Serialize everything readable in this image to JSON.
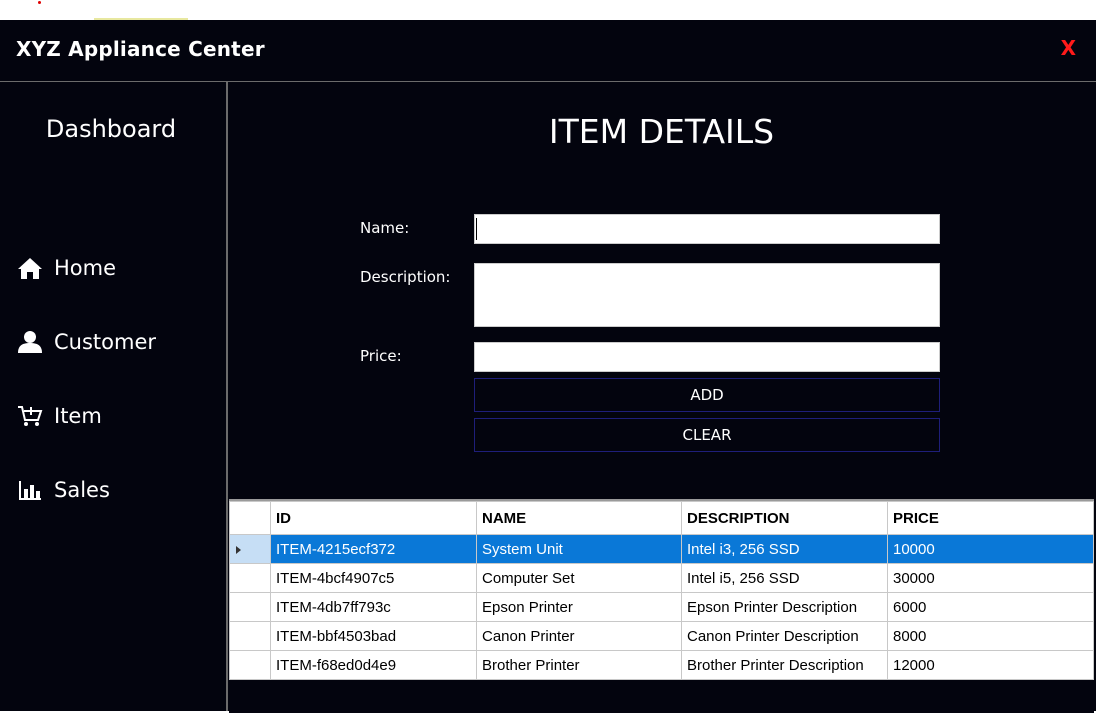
{
  "app": {
    "title": "XYZ Appliance Center",
    "close_label": "X"
  },
  "sidebar": {
    "title": "Dashboard",
    "items": [
      {
        "label": "Home",
        "icon": "home-icon"
      },
      {
        "label": "Customer",
        "icon": "user-icon"
      },
      {
        "label": "Item",
        "icon": "cart-icon"
      },
      {
        "label": "Sales",
        "icon": "bar-chart-icon"
      }
    ]
  },
  "main": {
    "title": "ITEM DETAILS",
    "form": {
      "name_label": "Name:",
      "name_value": "",
      "description_label": "Description:",
      "description_value": "",
      "price_label": "Price:",
      "price_value": "",
      "add_label": "ADD",
      "clear_label": "CLEAR"
    },
    "table": {
      "columns": [
        "ID",
        "NAME",
        "DESCRIPTION",
        "PRICE"
      ],
      "selected_row": 0,
      "rows": [
        [
          "ITEM-4215ecf372",
          "System Unit",
          "Intel i3, 256 SSD",
          "10000"
        ],
        [
          "ITEM-4bcf4907c5",
          "Computer Set",
          "Intel i5, 256 SSD",
          "30000"
        ],
        [
          "ITEM-4db7ff793c",
          "Epson Printer",
          "Epson Printer Description",
          "6000"
        ],
        [
          "ITEM-bbf4503bad",
          "Canon Printer",
          "Canon Printer Description",
          "8000"
        ],
        [
          "ITEM-f68ed0d4e9",
          "Brother Printer",
          "Brother Printer Description",
          "12000"
        ]
      ]
    }
  },
  "colors": {
    "background": "#03040e",
    "close": "#ff1a1a",
    "selection": "#0a78d7",
    "button_border": "#1e1e7a"
  }
}
